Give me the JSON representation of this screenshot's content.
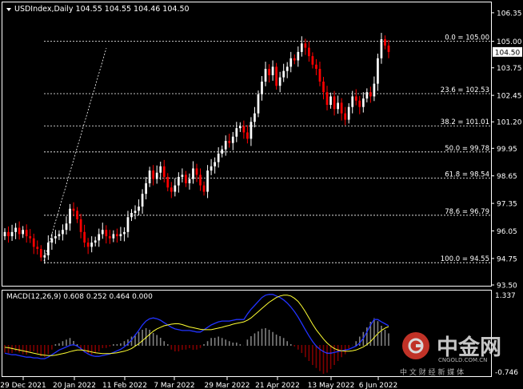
{
  "colors": {
    "background": "#000000",
    "frame": "#ffffff",
    "bull_candle": "#ffffff",
    "bear_candle": "#ff0000",
    "fib_line": "#ffffff",
    "macd_hist": "#ffffff",
    "macd_hist_neg": "#ff0000",
    "macd_line": "#2233ff",
    "signal_line": "#ffff33",
    "current_price_box": "#ffffff"
  },
  "header": {
    "title": "USDIndex,Daily  104.55 104.55 104.46 104.50"
  },
  "macd": {
    "label": "MACD(12,26,9) 0.608 0.252 0.464 0.000",
    "top_tick": "1.337",
    "bottom_tick": "-0.746"
  },
  "watermark": {
    "brand": "中金网",
    "domain": "CNGOLD.COM.CN",
    "tagline": "中 文 财 经 新 媒 体"
  },
  "chart_data": [
    {
      "type": "candlestick",
      "series_name": "USDIndex Daily",
      "current_price": "104.50",
      "ylim": [
        93.5,
        106.8
      ],
      "y_ticks": [
        "106.35",
        "105.00",
        "103.75",
        "102.45",
        "101.20",
        "99.95",
        "98.65",
        "97.35",
        "96.05",
        "94.75",
        "93.50"
      ],
      "x_ticks": [
        "29 Dec 2021",
        "20 Jan 2022",
        "11 Feb 2022",
        "7 Mar 2022",
        "29 Mar 2022",
        "21 Apr 2022",
        "13 May 2022",
        "6 Jun 2022"
      ],
      "fib_levels": [
        {
          "label": "0.0 = 105.00",
          "value": 105.0
        },
        {
          "label": "23.6 = 102.53",
          "value": 102.53
        },
        {
          "label": "38.2 = 101.01",
          "value": 101.01
        },
        {
          "label": "50.0 = 99.78",
          "value": 99.78
        },
        {
          "label": "61.8 = 98.54",
          "value": 98.54
        },
        {
          "label": "78.6 = 96.79",
          "value": 96.79
        },
        {
          "label": "100.0 = 94.55",
          "value": 94.55
        }
      ],
      "close_path": [
        96.0,
        95.8,
        96.0,
        96.2,
        95.9,
        96.1,
        95.8,
        95.7,
        95.3,
        95.2,
        94.8,
        94.9,
        95.5,
        95.7,
        95.8,
        95.9,
        96.1,
        96.4,
        97.1,
        97.0,
        96.6,
        96.0,
        95.5,
        95.3,
        95.5,
        95.6,
        95.9,
        96.1,
        95.8,
        95.7,
        95.9,
        95.8,
        95.9,
        96.0,
        96.7,
        96.9,
        97.0,
        97.2,
        97.8,
        98.3,
        98.9,
        98.5,
        98.8,
        99.1,
        98.6,
        98.1,
        97.9,
        98.2,
        98.6,
        98.7,
        98.3,
        98.5,
        99.0,
        98.7,
        98.2,
        97.9,
        98.9,
        99.1,
        99.3,
        99.7,
        99.9,
        100.3,
        100.2,
        100.5,
        100.9,
        101.0,
        100.7,
        100.4,
        101.2,
        101.6,
        102.5,
        103.1,
        103.7,
        103.4,
        103.8,
        102.9,
        103.3,
        103.6,
        103.8,
        104.2,
        104.1,
        104.5,
        104.9,
        104.7,
        104.3,
        103.9,
        103.7,
        103.1,
        102.6,
        102.0,
        102.4,
        101.8,
        102.1,
        101.6,
        101.3,
        101.9,
        102.4,
        102.2,
        101.9,
        102.3,
        102.6,
        102.4,
        103.0,
        104.2,
        105.1,
        104.8,
        104.5
      ],
      "macd_histogram": [
        -0.18,
        -0.22,
        -0.2,
        -0.15,
        -0.18,
        -0.22,
        -0.24,
        -0.2,
        -0.16,
        -0.2,
        -0.27,
        -0.3,
        -0.22,
        -0.1,
        0.02,
        0.05,
        0.1,
        0.14,
        0.18,
        0.12,
        0.02,
        -0.1,
        -0.18,
        -0.22,
        -0.24,
        -0.2,
        -0.15,
        -0.08,
        -0.06,
        -0.03,
        0.02,
        0.04,
        0.05,
        0.1,
        0.16,
        0.22,
        0.28,
        0.34,
        0.4,
        0.44,
        0.4,
        0.32,
        0.26,
        0.2,
        0.1,
        0.02,
        -0.1,
        -0.16,
        -0.16,
        -0.12,
        -0.1,
        -0.08,
        -0.12,
        -0.1,
        -0.06,
        0.04,
        0.1,
        0.18,
        0.2,
        0.22,
        0.18,
        0.14,
        0.1,
        0.08,
        0.06,
        0.02,
        0.0,
        0.14,
        0.24,
        0.3,
        0.36,
        0.42,
        0.44,
        0.4,
        0.34,
        0.28,
        0.24,
        0.18,
        0.1,
        0.04,
        -0.02,
        -0.1,
        -0.2,
        -0.3,
        -0.4,
        -0.5,
        -0.58,
        -0.66,
        -0.72,
        -0.7,
        -0.6,
        -0.5,
        -0.4,
        -0.3,
        -0.22,
        -0.1,
        0.0,
        0.1,
        0.22,
        0.34,
        0.46,
        0.6,
        0.7,
        0.62,
        0.5,
        0.4,
        0.3
      ],
      "macd_line": [
        -0.2,
        -0.22,
        -0.24,
        -0.24,
        -0.26,
        -0.28,
        -0.3,
        -0.3,
        -0.32,
        -0.32,
        -0.34,
        -0.34,
        -0.3,
        -0.24,
        -0.18,
        -0.12,
        -0.08,
        -0.04,
        0.0,
        0.02,
        -0.02,
        -0.08,
        -0.16,
        -0.22,
        -0.26,
        -0.28,
        -0.28,
        -0.26,
        -0.24,
        -0.22,
        -0.18,
        -0.14,
        -0.1,
        -0.04,
        0.04,
        0.14,
        0.26,
        0.38,
        0.52,
        0.62,
        0.68,
        0.7,
        0.68,
        0.64,
        0.58,
        0.52,
        0.46,
        0.42,
        0.4,
        0.38,
        0.38,
        0.38,
        0.36,
        0.34,
        0.34,
        0.4,
        0.46,
        0.52,
        0.56,
        0.6,
        0.62,
        0.62,
        0.62,
        0.64,
        0.66,
        0.66,
        0.66,
        0.8,
        0.92,
        1.02,
        1.12,
        1.22,
        1.28,
        1.3,
        1.3,
        1.26,
        1.22,
        1.16,
        1.08,
        0.98,
        0.86,
        0.72,
        0.56,
        0.4,
        0.24,
        0.1,
        -0.02,
        -0.1,
        -0.16,
        -0.2,
        -0.2,
        -0.18,
        -0.16,
        -0.14,
        -0.12,
        -0.1,
        -0.06,
        -0.02,
        0.06,
        0.18,
        0.34,
        0.52,
        0.66,
        0.66,
        0.6,
        0.55,
        0.5
      ],
      "signal_line": [
        -0.05,
        -0.06,
        -0.08,
        -0.1,
        -0.12,
        -0.14,
        -0.16,
        -0.18,
        -0.2,
        -0.22,
        -0.24,
        -0.25,
        -0.26,
        -0.26,
        -0.25,
        -0.23,
        -0.21,
        -0.19,
        -0.16,
        -0.14,
        -0.12,
        -0.12,
        -0.13,
        -0.15,
        -0.17,
        -0.19,
        -0.2,
        -0.21,
        -0.21,
        -0.21,
        -0.2,
        -0.19,
        -0.17,
        -0.15,
        -0.12,
        -0.08,
        -0.02,
        0.04,
        0.12,
        0.2,
        0.28,
        0.36,
        0.42,
        0.46,
        0.5,
        0.52,
        0.54,
        0.55,
        0.55,
        0.53,
        0.5,
        0.47,
        0.45,
        0.43,
        0.41,
        0.4,
        0.4,
        0.4,
        0.42,
        0.44,
        0.46,
        0.49,
        0.51,
        0.54,
        0.56,
        0.58,
        0.6,
        0.64,
        0.7,
        0.78,
        0.86,
        0.94,
        1.02,
        1.1,
        1.16,
        1.22,
        1.26,
        1.28,
        1.28,
        1.26,
        1.2,
        1.12,
        1.0,
        0.86,
        0.7,
        0.54,
        0.4,
        0.28,
        0.16,
        0.06,
        -0.02,
        -0.08,
        -0.12,
        -0.14,
        -0.15,
        -0.15,
        -0.14,
        -0.12,
        -0.08,
        -0.04,
        0.02,
        0.1,
        0.2,
        0.3,
        0.38,
        0.44,
        0.48
      ]
    }
  ]
}
